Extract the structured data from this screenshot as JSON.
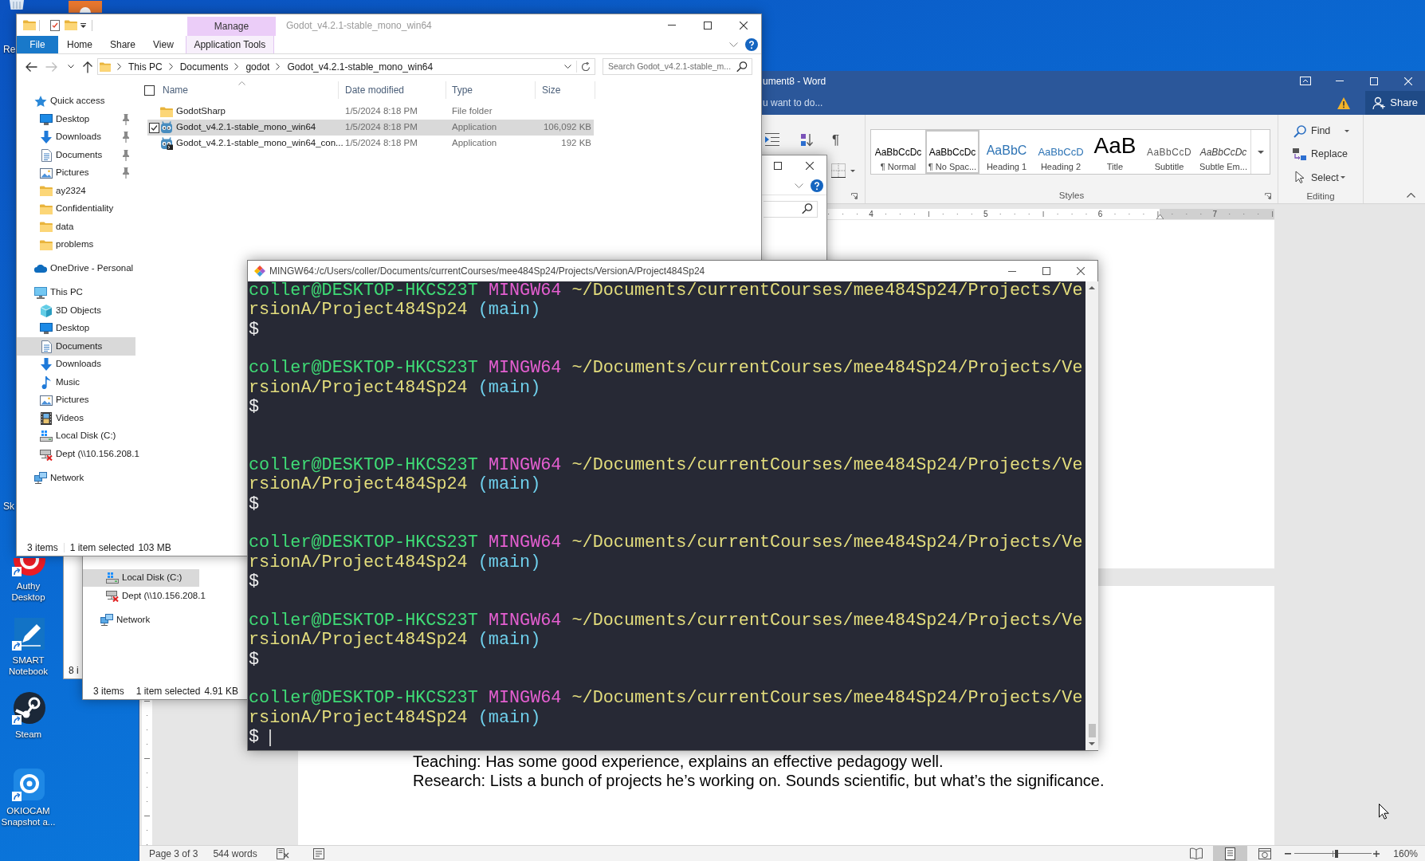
{
  "desktop": {
    "icons": [
      {
        "kind": "bin"
      },
      {
        "kind": "tile"
      },
      {
        "kind": "fragment",
        "label": "Re"
      },
      {
        "kind": "fragment",
        "label": "Sk"
      },
      {
        "kind": "authy",
        "label": "Authy Desktop"
      },
      {
        "kind": "smart",
        "label": "SMART Notebook"
      },
      {
        "kind": "steam",
        "label": "Steam"
      },
      {
        "kind": "okiocam",
        "label": "OKIOCAM Snapshot a..."
      }
    ]
  },
  "word": {
    "title": "ument8 - Word",
    "tell_me": "u want to do...",
    "share": "Share",
    "marks_button": "¶",
    "styles": [
      {
        "preview": "AaBbCcDc",
        "label": "¶ Normal",
        "kind": "normal",
        "selected": false
      },
      {
        "preview": "AaBbCcDc",
        "label": "¶ No Spac...",
        "kind": "normal",
        "selected": true
      },
      {
        "preview": "AaBbC",
        "label": "Heading 1",
        "kind": "heading1",
        "selected": false
      },
      {
        "preview": "AaBbCcD",
        "label": "Heading 2",
        "kind": "heading2",
        "selected": false
      },
      {
        "preview": "AaB",
        "label": "Title",
        "kind": "title",
        "selected": false
      },
      {
        "preview": "AaBbCcD",
        "label": "Subtitle",
        "kind": "subtitle",
        "selected": false
      },
      {
        "preview": "AaBbCcDc",
        "label": "Subtle Em...",
        "kind": "emphasis",
        "selected": false
      }
    ],
    "styles_group": "Styles",
    "editing": [
      {
        "label": "Find",
        "kind": "find"
      },
      {
        "label": "Replace",
        "kind": "replace"
      },
      {
        "label": "Select",
        "kind": "select"
      }
    ],
    "editing_group": "Editing",
    "ruler": [
      "4",
      "5",
      "6",
      "7"
    ],
    "page_text": [
      "Teaching: Has some good experience, explains an effective pedagogy well.",
      "Research: Lists a bunch of projects he’s working on. Sounds scientific, but what’s the significance."
    ],
    "status_bar": {
      "page": "Page 3 of 3",
      "words": "544 words",
      "views": [
        {
          "kind": "read",
          "selected": false
        },
        {
          "kind": "print",
          "selected": true
        },
        {
          "kind": "web",
          "selected": false
        }
      ],
      "zoom_slider": {
        "level": 0.55
      },
      "zoom": "160%"
    }
  },
  "window_behind": {
    "status": "8 i"
  },
  "explorer_back": {
    "sidebar": [
      {
        "children": [
          {
            "label": "Local Disk (C:)",
            "kind": "disk",
            "selected": true
          },
          {
            "label": "Dept (\\\\10.156.208.1",
            "kind": "netdrive",
            "selected": false
          }
        ]
      },
      {
        "label": "Network",
        "kind": "network",
        "selected": false
      }
    ],
    "status": {
      "items": "3 items",
      "selection": "1 item selected",
      "size": "4.91 KB"
    }
  },
  "explorer": {
    "title": "Godot_v4.2.1-stable_mono_win64",
    "context_label": "Manage",
    "tabs": [
      {
        "label": "File",
        "kind": "file",
        "selected": false
      },
      {
        "label": "Home",
        "kind": "tab",
        "selected": false
      },
      {
        "label": "Share",
        "kind": "tab",
        "selected": false
      },
      {
        "label": "View",
        "kind": "tab",
        "selected": false
      },
      {
        "label": "Application Tools",
        "kind": "context",
        "selected": false
      }
    ],
    "nav": [
      {
        "kind": "back",
        "disabled": false
      },
      {
        "kind": "forward",
        "disabled": true
      },
      {
        "kind": "recent",
        "disabled": false
      },
      {
        "kind": "up",
        "disabled": false
      }
    ],
    "breadcrumb": [
      "This PC",
      "Documents",
      "godot",
      "Godot_v4.2.1-stable_mono_win64"
    ],
    "search": {
      "placeholder": "Search Godot_v4.2.1-stable_m..."
    },
    "sidebar": [
      {
        "label": "Quick access",
        "kind": "star",
        "selected": false,
        "children": [
          {
            "label": "Desktop",
            "kind": "desktop",
            "pinned": true,
            "selected": false
          },
          {
            "label": "Downloads",
            "kind": "download",
            "pinned": true,
            "selected": false
          },
          {
            "label": "Documents",
            "kind": "documents",
            "pinned": true,
            "selected": false
          },
          {
            "label": "Pictures",
            "kind": "pictures",
            "pinned": true,
            "selected": false
          },
          {
            "label": "ay2324",
            "kind": "folder",
            "pinned": false,
            "selected": false
          },
          {
            "label": "Confidentiality",
            "kind": "folder",
            "pinned": false,
            "selected": false
          },
          {
            "label": "data",
            "kind": "folder",
            "pinned": false,
            "selected": false
          },
          {
            "label": "problems",
            "kind": "folder",
            "pinned": false,
            "selected": false
          }
        ]
      },
      {
        "label": "OneDrive - Personal",
        "kind": "cloud",
        "selected": false
      },
      {
        "label": "This PC",
        "kind": "pc",
        "selected": false,
        "children": [
          {
            "label": "3D Objects",
            "kind": "cube",
            "selected": false
          },
          {
            "label": "Desktop",
            "kind": "desktop",
            "selected": false
          },
          {
            "label": "Documents",
            "kind": "documents",
            "selected": true
          },
          {
            "label": "Downloads",
            "kind": "download",
            "selected": false
          },
          {
            "label": "Music",
            "kind": "music",
            "selected": false
          },
          {
            "label": "Pictures",
            "kind": "pictures",
            "selected": false
          },
          {
            "label": "Videos",
            "kind": "videos",
            "selected": false
          },
          {
            "label": "Local Disk (C:)",
            "kind": "disk",
            "selected": false
          },
          {
            "label": "Dept (\\\\10.156.208.1",
            "kind": "netdrive",
            "selected": false
          }
        ]
      },
      {
        "label": "Network",
        "kind": "network",
        "selected": false
      }
    ],
    "select_all": {
      "checked": false
    },
    "columns": [
      {
        "label": "Name",
        "sorted": true
      },
      {
        "label": "Date modified",
        "sorted": false
      },
      {
        "label": "Type",
        "sorted": false
      },
      {
        "label": "Size",
        "sorted": false
      }
    ],
    "rows": [
      {
        "name": "GodotSharp",
        "date": "1/5/2024 8:18 PM",
        "type": "File folder",
        "kind": "folder",
        "selected": false,
        "checked": false
      },
      {
        "name": "Godot_v4.2.1-stable_mono_win64",
        "date": "1/5/2024 8:18 PM",
        "type": "Application",
        "size": "106,092 KB",
        "kind": "app",
        "selected": true,
        "checked": true
      },
      {
        "name": "Godot_v4.2.1-stable_mono_win64_con...",
        "date": "1/5/2024 8:18 PM",
        "type": "Application",
        "size": "192 KB",
        "kind": "console",
        "selected": false,
        "checked": false
      }
    ],
    "status": {
      "items": "3 items",
      "selection": "1 item selected",
      "size": "103 MB"
    }
  },
  "terminal": {
    "title": "MINGW64:/c/Users/coller/Documents/currentCourses/mee484Sp24/Projects/VersionA/Project484Sp24",
    "lines": [
      {
        "kind": "prompt",
        "user": "coller@DESKTOP-HKCS23T",
        "system": "MINGW64",
        "path": "~/Documents/currentCourses/mee484Sp24/Projects/VersionA/Project484Sp24",
        "branch": "(main)"
      },
      {
        "kind": "input",
        "text": "$",
        "cursor": false
      },
      {
        "kind": "blank"
      },
      {
        "kind": "prompt",
        "user": "coller@DESKTOP-HKCS23T",
        "system": "MINGW64",
        "path": "~/Documents/currentCourses/mee484Sp24/Projects/VersionA/Project484Sp24",
        "branch": "(main)"
      },
      {
        "kind": "input",
        "text": "$",
        "cursor": false
      },
      {
        "kind": "blank"
      },
      {
        "kind": "blank"
      },
      {
        "kind": "prompt",
        "user": "coller@DESKTOP-HKCS23T",
        "system": "MINGW64",
        "path": "~/Documents/currentCourses/mee484Sp24/Projects/VersionA/Project484Sp24",
        "branch": "(main)"
      },
      {
        "kind": "input",
        "text": "$",
        "cursor": false
      },
      {
        "kind": "blank"
      },
      {
        "kind": "prompt",
        "user": "coller@DESKTOP-HKCS23T",
        "system": "MINGW64",
        "path": "~/Documents/currentCourses/mee484Sp24/Projects/VersionA/Project484Sp24",
        "branch": "(main)"
      },
      {
        "kind": "input",
        "text": "$",
        "cursor": false
      },
      {
        "kind": "blank"
      },
      {
        "kind": "prompt",
        "user": "coller@DESKTOP-HKCS23T",
        "system": "MINGW64",
        "path": "~/Documents/currentCourses/mee484Sp24/Projects/VersionA/Project484Sp24",
        "branch": "(main)"
      },
      {
        "kind": "input",
        "text": "$",
        "cursor": false
      },
      {
        "kind": "blank"
      },
      {
        "kind": "prompt",
        "user": "coller@DESKTOP-HKCS23T",
        "system": "MINGW64",
        "path": "~/Documents/currentCourses/mee484Sp24/Projects/VersionA/Project484Sp24",
        "branch": "(main)"
      },
      {
        "kind": "input",
        "text": "$",
        "cursor": true
      }
    ]
  }
}
